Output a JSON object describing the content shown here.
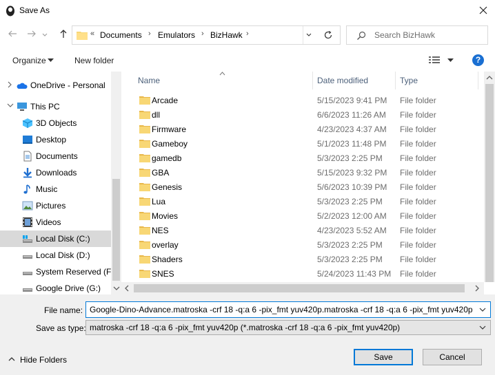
{
  "window": {
    "title": "Save As"
  },
  "address": {
    "crumbs": [
      "Documents",
      "Emulators",
      "BizHawk"
    ]
  },
  "search": {
    "placeholder": "Search BizHawk"
  },
  "toolbar": {
    "organize": "Organize",
    "new_folder": "New folder"
  },
  "nav": {
    "items": [
      {
        "label": "OneDrive - Personal",
        "icon": "cloud-icon"
      },
      {
        "label": "This PC",
        "icon": "computer-icon"
      },
      {
        "label": "3D Objects",
        "icon": "cube-icon"
      },
      {
        "label": "Desktop",
        "icon": "desktop-icon"
      },
      {
        "label": "Documents",
        "icon": "documents-icon"
      },
      {
        "label": "Downloads",
        "icon": "download-icon"
      },
      {
        "label": "Music",
        "icon": "music-icon"
      },
      {
        "label": "Pictures",
        "icon": "pictures-icon"
      },
      {
        "label": "Videos",
        "icon": "videos-icon"
      },
      {
        "label": "Local Disk (C:)",
        "icon": "disk-icon"
      },
      {
        "label": "Local Disk (D:)",
        "icon": "disk-icon"
      },
      {
        "label": "System Reserved (F:)",
        "icon": "disk-icon"
      },
      {
        "label": "Google Drive (G:)",
        "icon": "disk-icon"
      }
    ]
  },
  "columns": {
    "name": "Name",
    "date": "Date modified",
    "type": "Type"
  },
  "files": [
    {
      "name": "Arcade",
      "date": "5/15/2023 9:41 PM",
      "type": "File folder"
    },
    {
      "name": "dll",
      "date": "6/6/2023 11:26 AM",
      "type": "File folder"
    },
    {
      "name": "Firmware",
      "date": "4/23/2023 4:37 AM",
      "type": "File folder"
    },
    {
      "name": "Gameboy",
      "date": "5/1/2023 11:48 PM",
      "type": "File folder"
    },
    {
      "name": "gamedb",
      "date": "5/3/2023 2:25 PM",
      "type": "File folder"
    },
    {
      "name": "GBA",
      "date": "5/15/2023 9:32 PM",
      "type": "File folder"
    },
    {
      "name": "Genesis",
      "date": "5/6/2023 10:39 PM",
      "type": "File folder"
    },
    {
      "name": "Lua",
      "date": "5/3/2023 2:25 PM",
      "type": "File folder"
    },
    {
      "name": "Movies",
      "date": "5/2/2023 12:00 AM",
      "type": "File folder"
    },
    {
      "name": "NES",
      "date": "4/23/2023 5:52 AM",
      "type": "File folder"
    },
    {
      "name": "overlay",
      "date": "5/3/2023 2:25 PM",
      "type": "File folder"
    },
    {
      "name": "Shaders",
      "date": "5/3/2023 2:25 PM",
      "type": "File folder"
    },
    {
      "name": "SNES",
      "date": "5/24/2023 11:43 PM",
      "type": "File folder"
    }
  ],
  "form": {
    "file_name_label": "File name:",
    "file_name_value": "Google-Dino-Advance.matroska -crf 18 -q:a 6 -pix_fmt yuv420p.matroska -crf 18 -q:a 6 -pix_fmt yuv420p",
    "save_type_label": "Save as type:",
    "save_type_value": "matroska -crf 18 -q:a 6 -pix_fmt yuv420p (*.matroska -crf 18 -q:a 6 -pix_fmt yuv420p)"
  },
  "footer": {
    "hide_folders": "Hide Folders",
    "save": "Save",
    "cancel": "Cancel"
  },
  "colors": {
    "accent": "#0078d7",
    "selection": "#cce8ff",
    "folder": "#f8d775"
  }
}
